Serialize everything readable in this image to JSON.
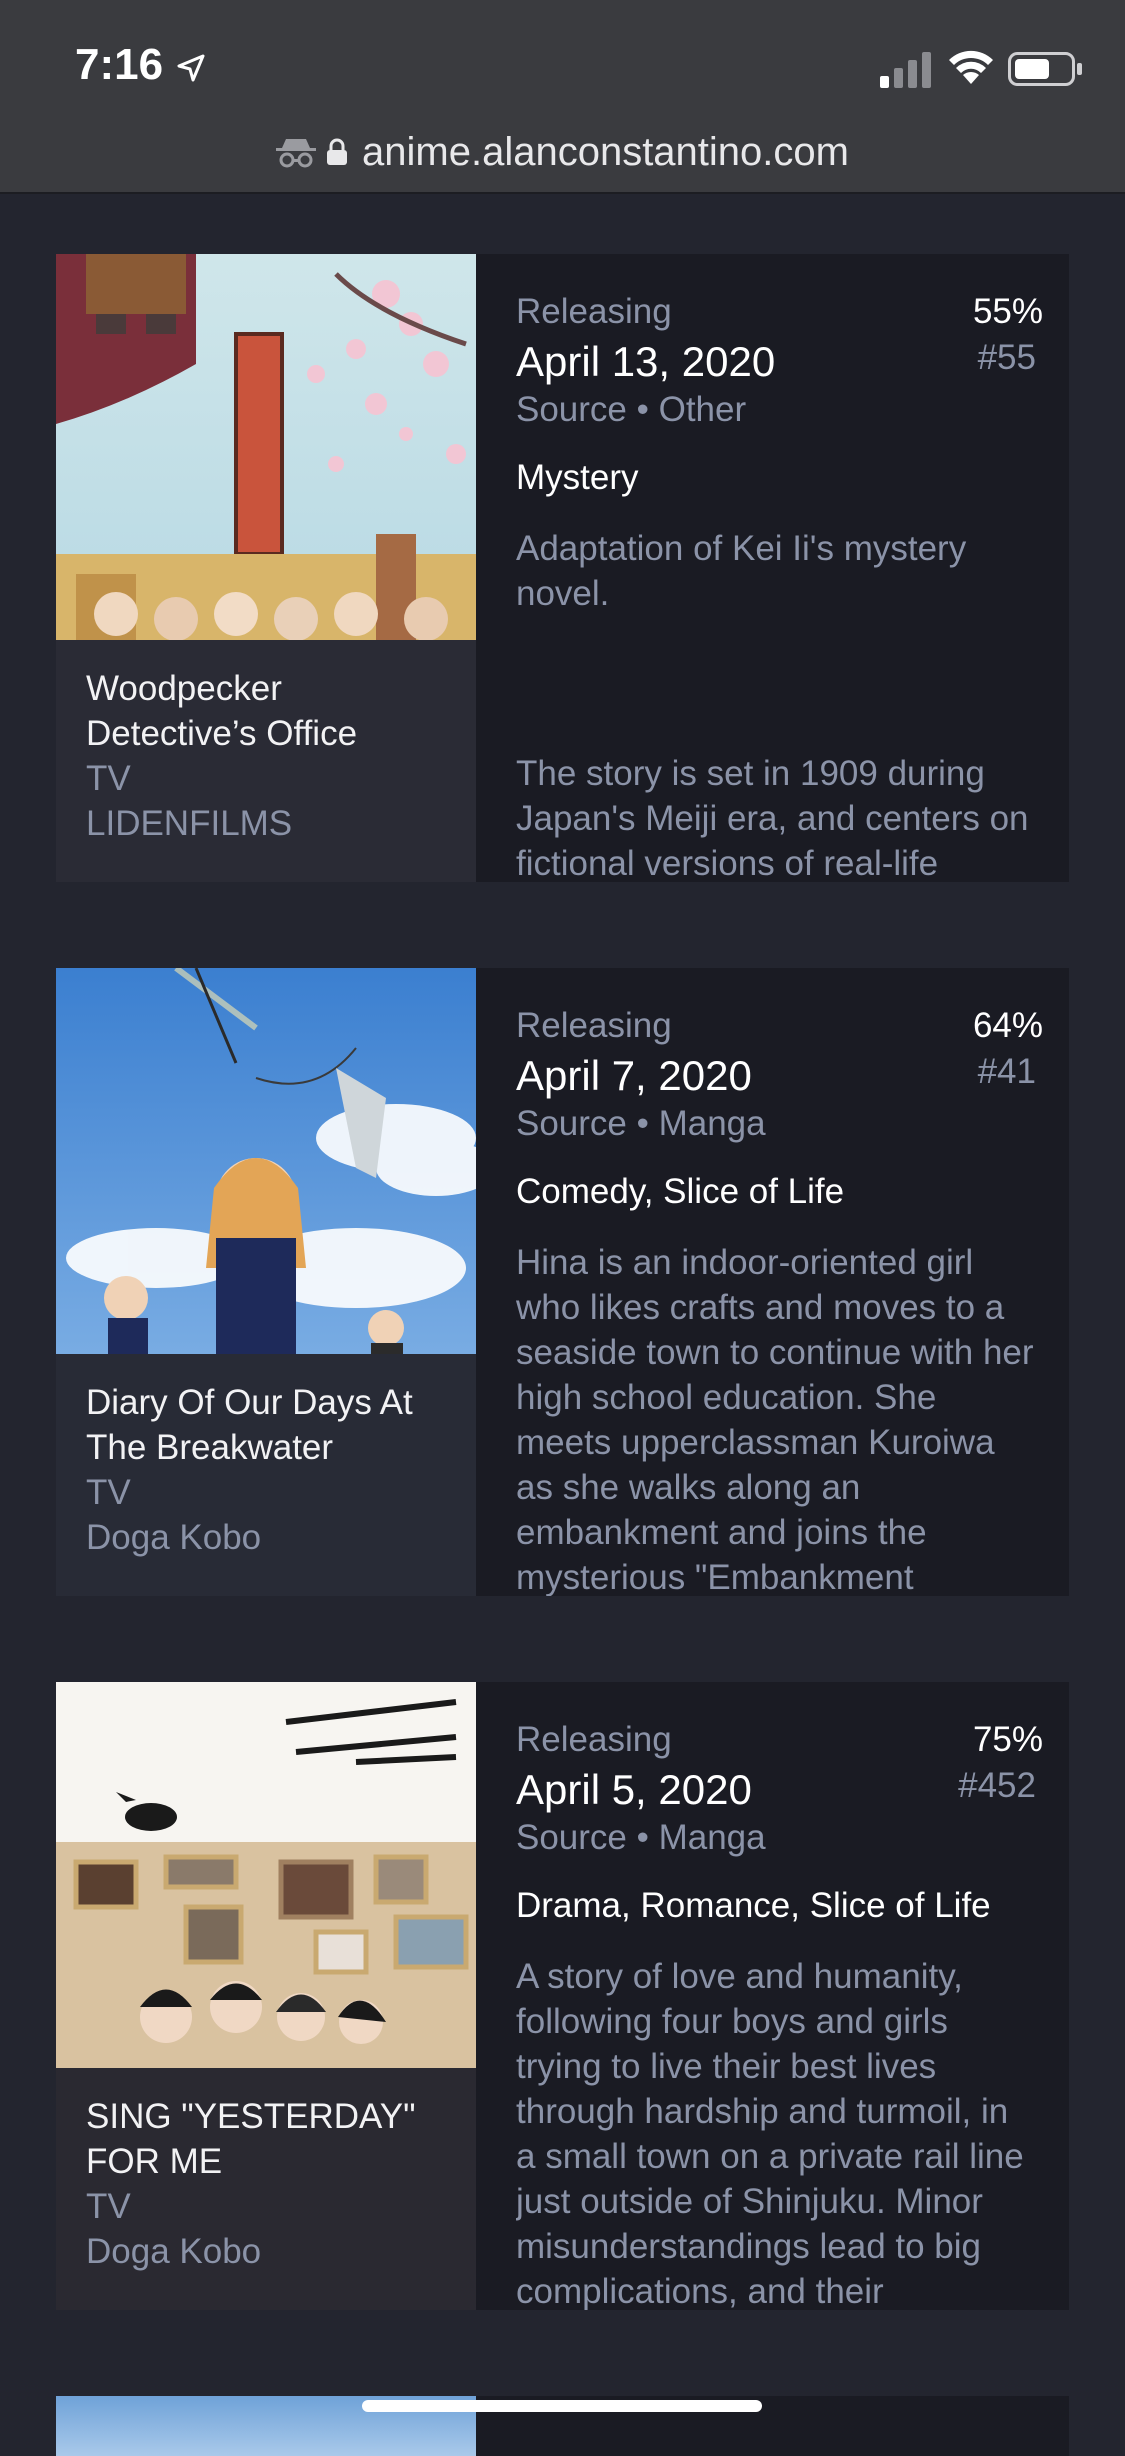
{
  "status_bar": {
    "time": "7:16"
  },
  "browser": {
    "url": "anime.alanconstantino.com"
  },
  "cards": [
    {
      "title": "Woodpecker Detective’s Office",
      "format": "TV",
      "studio": "LIDENFILMS",
      "status": "Releasing",
      "date": "April 13, 2020",
      "source": "Source • Other",
      "score": "55%",
      "rank": "#55",
      "genres": "Mystery",
      "description": "Adaptation of Kei Ii's mystery novel.",
      "description_more": "The story is set in 1909 during Japan's Meiji era, and centers on fictional versions of real-life"
    },
    {
      "title": "Diary Of Our Days At The Breakwater",
      "format": "TV",
      "studio": "Doga Kobo",
      "status": "Releasing",
      "date": "April 7, 2020",
      "source": "Source • Manga",
      "score": "64%",
      "rank": "#41",
      "genres": "Comedy, Slice of Life",
      "description": "Hina is an indoor-oriented girl who likes crafts and moves to a seaside town to continue with her high school education. She meets upperclassman Kuroiwa as she walks along an embankment and joins the mysterious \"Embankment"
    },
    {
      "title": "SING \"YESTERDAY\" FOR ME",
      "format": "TV",
      "studio": "Doga Kobo",
      "status": "Releasing",
      "date": "April 5, 2020",
      "source": "Source • Manga",
      "score": "75%",
      "rank": "#452",
      "genres": "Drama, Romance, Slice of Life",
      "description": "A story of love and humanity, following four boys and girls trying to live their best lives through hardship and turmoil, in a small town on a private rail line just outside of Shinjuku. Minor misunderstandings lead to big complications, and their"
    }
  ]
}
